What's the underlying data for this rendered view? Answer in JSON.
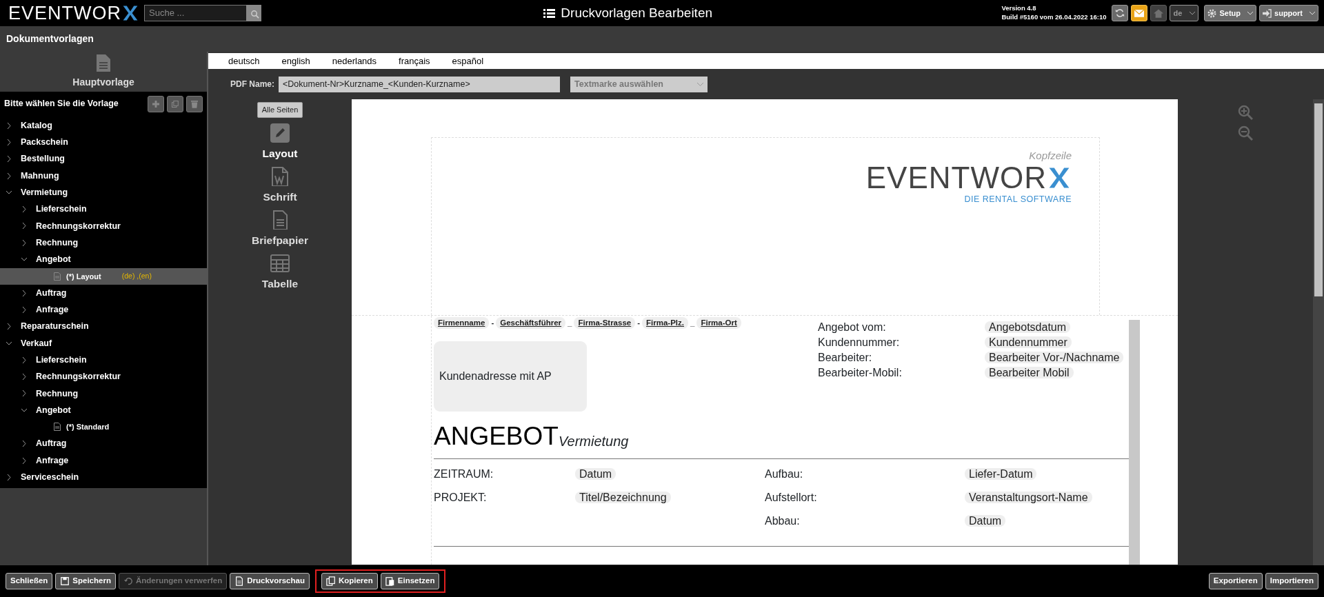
{
  "topbar": {
    "logo": "EVENTWOR",
    "search": {
      "placeholder": "Suche ..."
    },
    "title": "Druckvorlagen Bearbeiten",
    "version": "Version 4.8",
    "build": "Build #5160 vom 26.04.2022 16:10",
    "language": "de",
    "setup": "Setup",
    "user": "support"
  },
  "subheader": {
    "title": "Dokumentvorlagen"
  },
  "sidebar": {
    "main_template": "Hauptvorlage",
    "prompt": "Bitte wählen Sie die Vorlage",
    "tree": [
      {
        "label": "Katalog",
        "kind": "folder",
        "expanded": false,
        "selected": false
      },
      {
        "label": "Packschein",
        "kind": "folder",
        "expanded": false,
        "selected": false
      },
      {
        "label": "Bestellung",
        "kind": "folder",
        "expanded": false,
        "selected": false
      },
      {
        "label": "Mahnung",
        "kind": "folder",
        "expanded": false,
        "selected": false
      },
      {
        "label": "Vermietung",
        "kind": "folder",
        "expanded": true,
        "selected": false,
        "children": [
          {
            "label": "Lieferschein",
            "kind": "folder",
            "expanded": false,
            "selected": false
          },
          {
            "label": "Rechnungskorrektur",
            "kind": "folder",
            "expanded": false,
            "selected": false
          },
          {
            "label": "Rechnung",
            "kind": "folder",
            "expanded": false,
            "selected": false
          },
          {
            "label": "Angebot",
            "kind": "folder",
            "expanded": true,
            "selected": false,
            "children": [
              {
                "label": "(*) Layout",
                "kind": "document",
                "selected": true,
                "languages": "(de) ,(en)"
              }
            ]
          },
          {
            "label": "Auftrag",
            "kind": "folder",
            "expanded": false,
            "selected": false
          },
          {
            "label": "Anfrage",
            "kind": "folder",
            "expanded": false,
            "selected": false
          }
        ]
      },
      {
        "label": "Reparaturschein",
        "kind": "folder",
        "expanded": false,
        "selected": false
      },
      {
        "label": "Verkauf",
        "kind": "folder",
        "expanded": true,
        "selected": false,
        "children": [
          {
            "label": "Lieferschein",
            "kind": "folder",
            "expanded": false,
            "selected": false
          },
          {
            "label": "Rechnungskorrektur",
            "kind": "folder",
            "expanded": false,
            "selected": false
          },
          {
            "label": "Rechnung",
            "kind": "folder",
            "expanded": false,
            "selected": false
          },
          {
            "label": "Angebot",
            "kind": "folder",
            "expanded": true,
            "selected": false,
            "children": [
              {
                "label": "(*) Standard",
                "kind": "document",
                "selected": false
              }
            ]
          },
          {
            "label": "Auftrag",
            "kind": "folder",
            "expanded": false,
            "selected": false
          },
          {
            "label": "Anfrage",
            "kind": "folder",
            "expanded": false,
            "selected": false
          }
        ]
      },
      {
        "label": "Serviceschein",
        "kind": "folder",
        "expanded": false,
        "selected": false
      }
    ]
  },
  "language_tabs": [
    "deutsch",
    "english",
    "nederlands",
    "français",
    "español"
  ],
  "pdf_name": {
    "label": "PDF Name:",
    "value": "<Dokument-Nr>Kurzname_<Kunden-Kurzname>",
    "bookmark_placeholder": "Textmarke auswählen"
  },
  "tools": {
    "all_pages": "Alle Seiten",
    "items": [
      {
        "label": "Layout",
        "kind": "pencil",
        "selected": true
      },
      {
        "label": "Schrift",
        "kind": "font",
        "selected": false
      },
      {
        "label": "Briefpapier",
        "kind": "paper",
        "selected": false
      },
      {
        "label": "Tabelle",
        "kind": "table",
        "selected": false
      }
    ]
  },
  "document": {
    "header_label": "Kopfzeile",
    "logo": "EVENTWOR",
    "logo_tagline": "DIE RENTAL SOFTWARE",
    "company_line": [
      {
        "text": "Firmenname",
        "kind": "field"
      },
      {
        "text": "-",
        "kind": "separator"
      },
      {
        "text": "Geschäftsführer",
        "kind": "field"
      },
      {
        "text": "_",
        "kind": "separator"
      },
      {
        "text": "Firma-Strasse",
        "kind": "field"
      },
      {
        "text": "-",
        "kind": "separator"
      },
      {
        "text": "Firma-Plz.",
        "kind": "field"
      },
      {
        "text": "_",
        "kind": "separator"
      },
      {
        "text": "Firma-Ort",
        "kind": "field"
      }
    ],
    "address": "Kundenadresse mit AP",
    "info": [
      {
        "label": "Angebot vom:",
        "value": "Angebotsdatum"
      },
      {
        "label": "Kundennummer:",
        "value": "Kundennummer"
      },
      {
        "label": "Bearbeiter:",
        "value": "Bearbeiter Vor-/Nachname"
      },
      {
        "label": "Bearbeiter-Mobil:",
        "value": "Bearbeiter Mobil"
      }
    ],
    "heading": "ANGEBOT",
    "subheading": "Vermietung",
    "details": [
      {
        "label": "ZEITRAUM:",
        "value": "Datum",
        "label_2": "Aufbau:",
        "value_2": "Liefer-Datum"
      },
      {
        "label": "PROJEKT:",
        "value": "Titel/Bezeichnung",
        "label_2": "Aufstellort:",
        "value_2": "Veranstaltungsort-Name"
      },
      {
        "label_2": "Abbau:",
        "value_2": "Datum"
      }
    ]
  },
  "footer": {
    "left": [
      {
        "label": "Schließen",
        "kind": "plain",
        "disabled": false
      },
      {
        "label": "Speichern",
        "kind": "save",
        "disabled": false
      },
      {
        "label": "Änderungen verwerfen",
        "kind": "undo",
        "disabled": true
      },
      {
        "label": "Druckvorschau",
        "kind": "document",
        "disabled": false
      }
    ],
    "highlighted": [
      {
        "label": "Kopieren",
        "kind": "copy",
        "disabled": false
      },
      {
        "label": "Einsetzen",
        "kind": "paste",
        "disabled": false
      }
    ],
    "right": [
      "Exportieren",
      "Importieren"
    ]
  }
}
